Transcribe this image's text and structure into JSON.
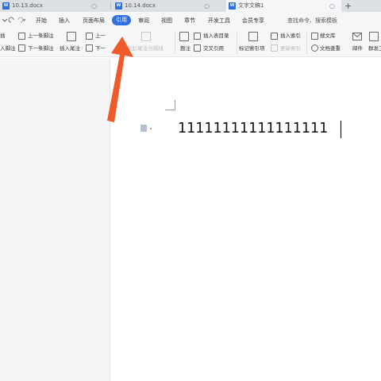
{
  "tabs": [
    {
      "icon": "W",
      "label": "10.13.docx"
    },
    {
      "icon": "W",
      "label": "10.14.docx"
    },
    {
      "icon": "W",
      "label": "文字文稿1"
    }
  ],
  "tab_close_glyph": "○",
  "new_tab_glyph": "+",
  "menu": {
    "items": [
      "开始",
      "插入",
      "页面布局",
      "引用",
      "审阅",
      "视图",
      "章节",
      "开发工具",
      "会员专享"
    ],
    "selected": "引用",
    "search_placeholder": "查找命令、搜索模板"
  },
  "ribbon": {
    "col1_top": "上一条脚注",
    "col1_bottom": "下一条脚注",
    "col1_left_top": "插",
    "col1_left_bottom": "入脚注",
    "insert_endnote": "插入尾注",
    "col3_top": "上一",
    "col3_bottom": "下一",
    "footnote_sep": "脚注/尾注分隔线",
    "caption": "题注",
    "insert_toc": "插入表目录",
    "cross_ref": "交叉引用",
    "mark_index": "标记索引项",
    "insert_index": "插入索引",
    "update_index": "更新索引",
    "search_doc": "搜文库",
    "doc_check": "文档查重",
    "mail": "邮件",
    "batch": "群发工"
  },
  "document": {
    "text": "11111111111111111"
  },
  "colors": {
    "accent": "#2f6fe0",
    "pointer_arrow": "#f05a28"
  }
}
